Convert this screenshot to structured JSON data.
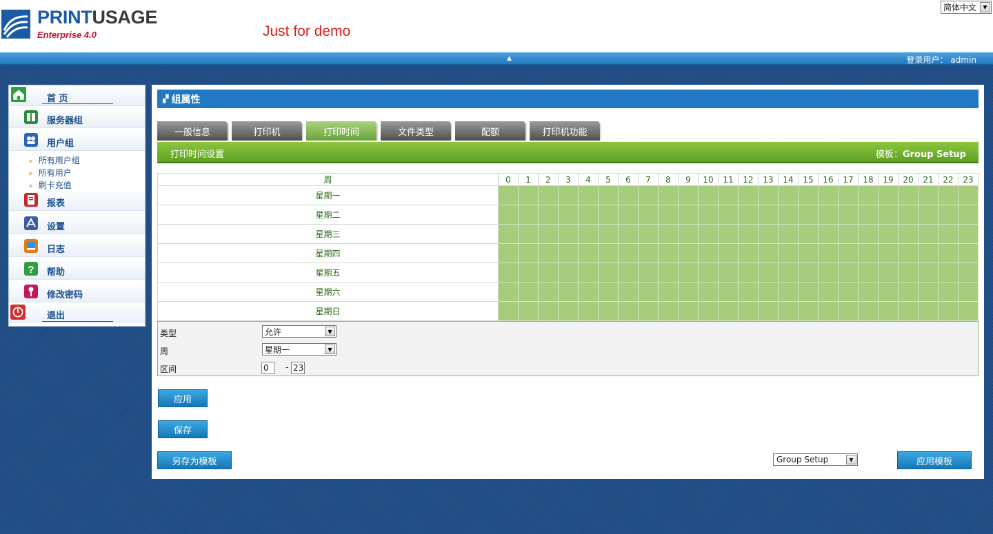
{
  "header": {
    "logo_part1": "PRINT",
    "logo_part2": "USAGE",
    "logo_sub": "Enterprise 4.0",
    "demo_text": "Just for demo",
    "language": "简体中文"
  },
  "topbar": {
    "login_label": "登录用户：",
    "login_user": "admin"
  },
  "sidebar": {
    "items": [
      {
        "label": "首 页",
        "icon": "home-icon",
        "color": "#2e9e3e"
      },
      {
        "label": "服务器组",
        "icon": "server-group-icon",
        "color": "#2e8b3a"
      },
      {
        "label": "用户组",
        "icon": "user-group-icon",
        "color": "#2b63b8"
      },
      {
        "label": "报表",
        "icon": "report-icon",
        "color": "#c62828"
      },
      {
        "label": "设置",
        "icon": "settings-icon",
        "color": "#3b5aa8"
      },
      {
        "label": "日志",
        "icon": "log-icon",
        "color": "#e07b1a"
      },
      {
        "label": "帮助",
        "icon": "help-icon",
        "color": "#2e9e3e"
      },
      {
        "label": "修改密码",
        "icon": "key-icon",
        "color": "#c2185b"
      },
      {
        "label": "退出",
        "icon": "power-icon",
        "color": "#d32f2f"
      }
    ],
    "sub_items": [
      "所有用户组",
      "所有用户",
      "刷卡充值"
    ]
  },
  "panel": {
    "title": "组属性",
    "tabs": [
      "一般信息",
      "打印机",
      "打印时间",
      "文件类型",
      "配额",
      "打印机功能"
    ],
    "active_tab": 2,
    "section_title": "打印时间设置",
    "template_label": "模板：",
    "template_name": "Group Setup"
  },
  "grid": {
    "day_header": "周",
    "hours": [
      "0",
      "1",
      "2",
      "3",
      "4",
      "5",
      "6",
      "7",
      "8",
      "9",
      "10",
      "11",
      "12",
      "13",
      "14",
      "15",
      "16",
      "17",
      "18",
      "19",
      "20",
      "21",
      "22",
      "23"
    ],
    "days": [
      "星期一",
      "星期二",
      "星期三",
      "星期四",
      "星期五",
      "星期六",
      "星期日"
    ],
    "allowed_color": "#a6cc7c"
  },
  "form": {
    "type_label": "类型",
    "type_value": "允许",
    "week_label": "周",
    "week_value": "星期一",
    "range_label": "区间",
    "range_from": "0",
    "range_sep": "-",
    "range_to": "23"
  },
  "buttons": {
    "apply": "应用",
    "save": "保存",
    "save_as_template": "另存为模板",
    "template_select": "Group Setup",
    "apply_template": "应用模板"
  }
}
